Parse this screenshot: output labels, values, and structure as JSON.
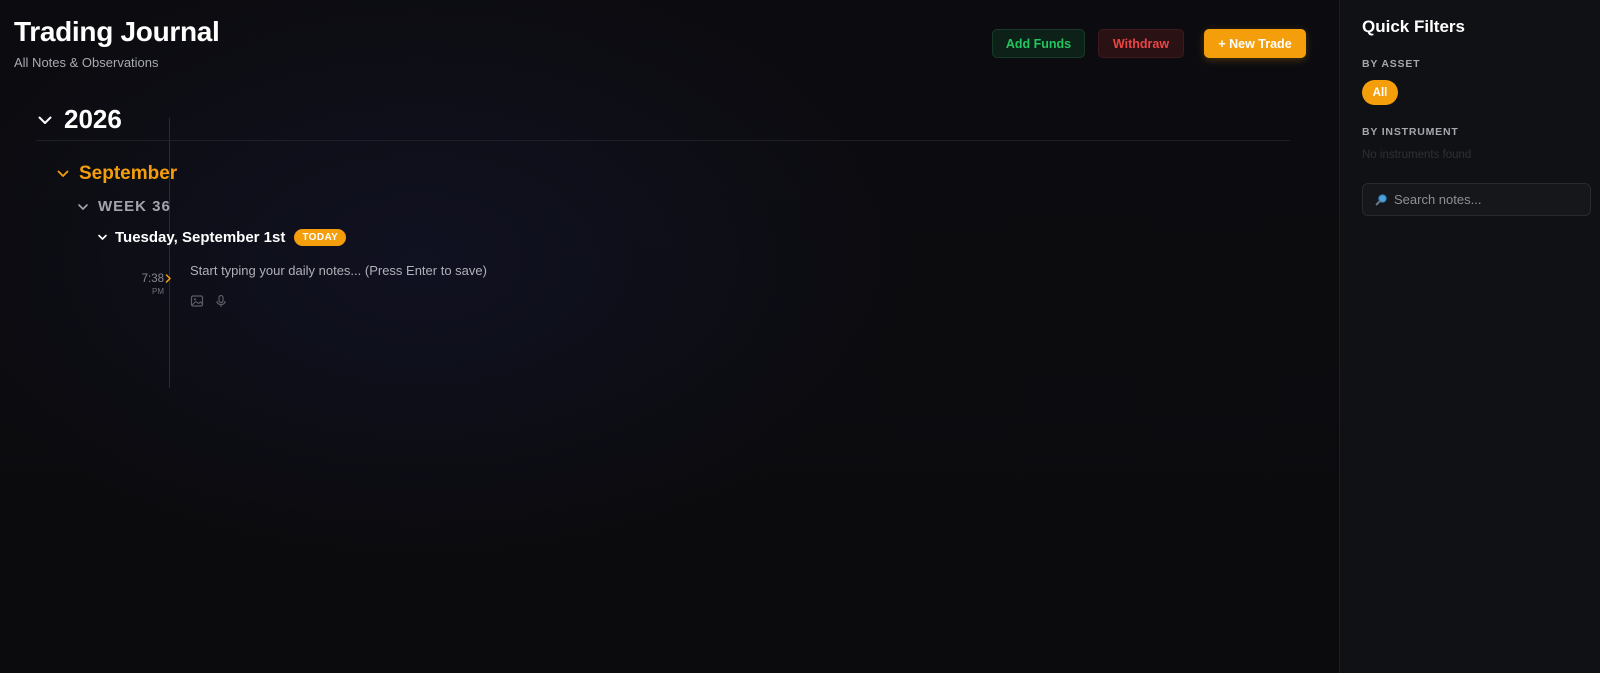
{
  "header": {
    "title": "Trading Journal",
    "subtitle": "All Notes & Observations",
    "add_funds_label": "Add Funds",
    "withdraw_label": "Withdraw",
    "new_trade_label": "+ New Trade"
  },
  "timeline": {
    "year": "2026",
    "month": "September",
    "week": "WEEK 36",
    "day": "Tuesday, September 1st",
    "today_badge": "TODAY",
    "entry": {
      "time": "7:38",
      "ampm": "PM",
      "placeholder": "Start typing your daily notes... (Press Enter to save)",
      "value": ""
    },
    "tools": [
      "image-icon",
      "microphone-icon"
    ]
  },
  "sidebar": {
    "title": "Quick Filters",
    "by_asset_label": "BY ASSET",
    "asset_chips": [
      "All"
    ],
    "by_instrument_label": "BY INSTRUMENT",
    "no_instruments_text": "No instruments found",
    "search_placeholder": "Search notes...",
    "search_value": ""
  },
  "colors": {
    "accent": "#f59e0b",
    "positive": "#22c55e",
    "negative": "#ef4444",
    "background": "#0b0b0f",
    "sidebar_background": "#101114"
  }
}
